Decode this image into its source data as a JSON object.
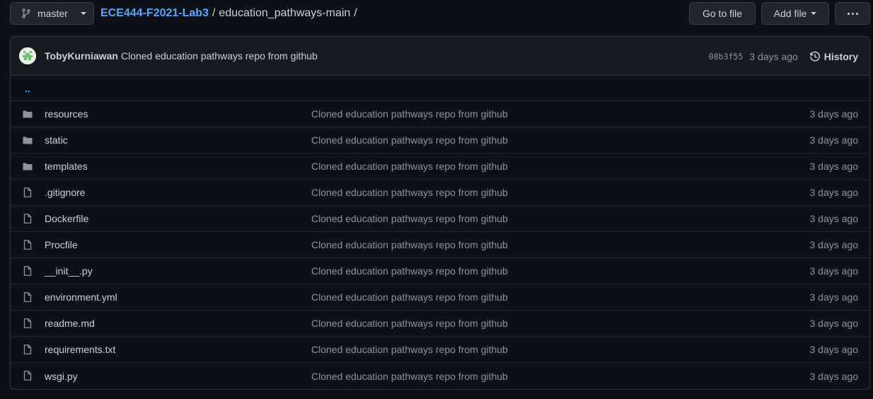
{
  "header": {
    "branch": "master",
    "repo": "ECE444-F2021-Lab3",
    "path_sep": "/",
    "directory": "education_pathways-main",
    "trailing_sep": "/",
    "go_to_file": "Go to file",
    "add_file": "Add file"
  },
  "commit": {
    "author": "TobyKurniawan",
    "message": "Cloned education pathways repo from github",
    "sha": "08b3f55",
    "time": "3 days ago",
    "history_label": "History"
  },
  "parent_link": "..",
  "files": [
    {
      "name": "resources",
      "type": "dir",
      "message": "Cloned education pathways repo from github",
      "time": "3 days ago"
    },
    {
      "name": "static",
      "type": "dir",
      "message": "Cloned education pathways repo from github",
      "time": "3 days ago"
    },
    {
      "name": "templates",
      "type": "dir",
      "message": "Cloned education pathways repo from github",
      "time": "3 days ago"
    },
    {
      "name": ".gitignore",
      "type": "file",
      "message": "Cloned education pathways repo from github",
      "time": "3 days ago"
    },
    {
      "name": "Dockerfile",
      "type": "file",
      "message": "Cloned education pathways repo from github",
      "time": "3 days ago"
    },
    {
      "name": "Procfile",
      "type": "file",
      "message": "Cloned education pathways repo from github",
      "time": "3 days ago"
    },
    {
      "name": "__init__.py",
      "type": "file",
      "message": "Cloned education pathways repo from github",
      "time": "3 days ago"
    },
    {
      "name": "environment.yml",
      "type": "file",
      "message": "Cloned education pathways repo from github",
      "time": "3 days ago"
    },
    {
      "name": "readme.md",
      "type": "file",
      "message": "Cloned education pathways repo from github",
      "time": "3 days ago"
    },
    {
      "name": "requirements.txt",
      "type": "file",
      "message": "Cloned education pathways repo from github",
      "time": "3 days ago"
    },
    {
      "name": "wsgi.py",
      "type": "file",
      "message": "Cloned education pathways repo from github",
      "time": "3 days ago"
    }
  ],
  "colors": {
    "background": "#0d1117",
    "link": "#58a6ff",
    "muted": "#8b949e",
    "border": "#30363d"
  },
  "icons": {
    "branch": "git-branch-icon",
    "history": "history-clock-icon",
    "directory": "folder-icon",
    "file": "file-icon",
    "more": "kebab-horizontal-icon"
  }
}
